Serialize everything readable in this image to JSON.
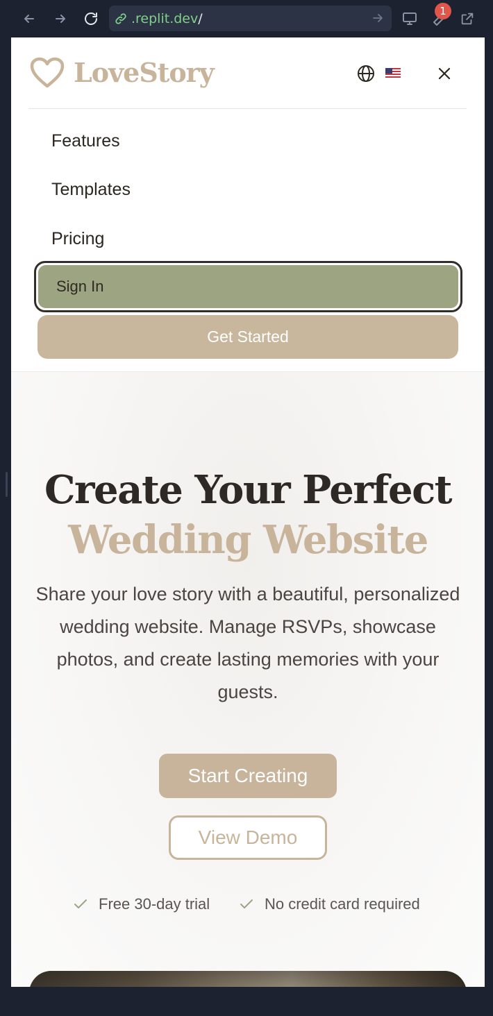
{
  "browser": {
    "url_host": ".replit.dev",
    "url_path": "/",
    "notification_count": "1"
  },
  "header": {
    "logo_text": "LoveStory",
    "language_flag": "🇺🇸"
  },
  "menu": {
    "items": [
      {
        "label": "Features"
      },
      {
        "label": "Templates"
      },
      {
        "label": "Pricing"
      }
    ],
    "sign_in_label": "Sign In",
    "get_started_label": "Get Started"
  },
  "hero": {
    "title_line1": "Create Your Perfect",
    "title_line2": "Wedding Website",
    "subtitle": "Share your love story with a beautiful, personalized wedding website. Manage RSVPs, showcase photos, and create lasting memories with your guests.",
    "primary_cta": "Start Creating",
    "secondary_cta": "View Demo",
    "perks": [
      {
        "label": "Free 30-day trial"
      },
      {
        "label": "No credit card required"
      }
    ]
  },
  "colors": {
    "brand_tan": "#c7b49a",
    "sign_in_green": "#9ca482",
    "dark_text": "#2f2926",
    "chrome_bg": "#1c2230"
  }
}
